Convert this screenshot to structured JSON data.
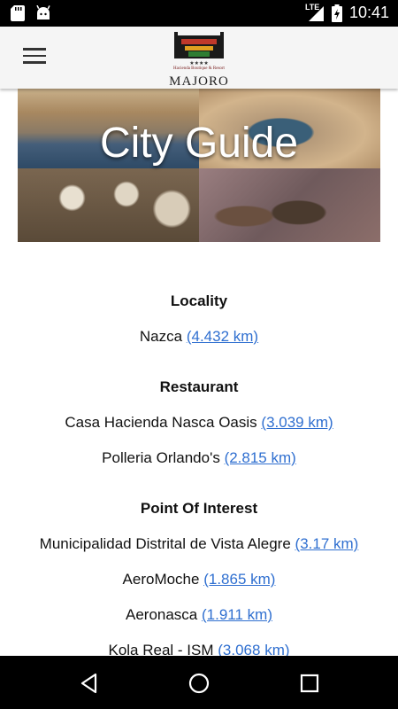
{
  "status_bar": {
    "time": "10:41",
    "network": "LTE",
    "icons": [
      "sd-card-icon",
      "android-icon",
      "signal-icon",
      "battery-icon"
    ]
  },
  "app_bar": {
    "menu_icon": "hamburger-menu-icon",
    "logo": {
      "brand": "MAJORO",
      "tagline": "Hacienda Boutique & Resort"
    }
  },
  "hero": {
    "title": "City Guide"
  },
  "sections": [
    {
      "title": "Locality",
      "items": [
        {
          "name": "Nazca",
          "distance": "(4.432 km)"
        }
      ]
    },
    {
      "title": "Restaurant",
      "items": [
        {
          "name": "Casa Hacienda Nasca Oasis",
          "distance": "(3.039 km)"
        },
        {
          "name": "Polleria Orlando's",
          "distance": "(2.815 km)"
        }
      ]
    },
    {
      "title": "Point Of Interest",
      "items": [
        {
          "name": "Municipalidad Distrital de Vista Alegre",
          "distance": "(3.17 km)"
        },
        {
          "name": "AeroMoche",
          "distance": "(1.865 km)"
        },
        {
          "name": "Aeronasca",
          "distance": "(1.911 km)"
        },
        {
          "name": "Kola Real - ISM",
          "distance": "(3.068 km)"
        }
      ]
    }
  ],
  "nav_bar": {
    "icons": [
      "back-icon",
      "home-icon",
      "recents-icon"
    ]
  },
  "colors": {
    "link": "#2f6fd0",
    "status_bar": "#000000",
    "app_bar": "#f5f5f5"
  }
}
